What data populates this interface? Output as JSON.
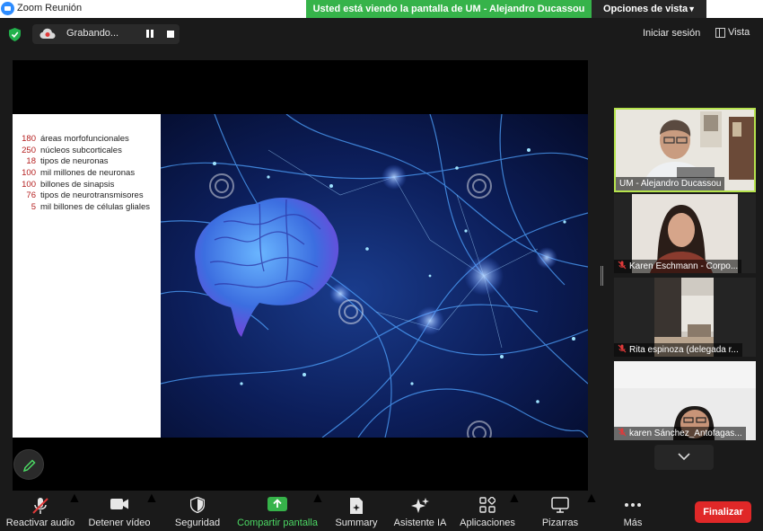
{
  "window": {
    "title": "Zoom Reunión",
    "sharing_banner": "Usted está viendo la pantalla de UM - Alejandro Ducassou",
    "view_options": "Opciones de vista"
  },
  "topbar": {
    "recording_label": "Grabando...",
    "signin": "Iniciar sesión",
    "view": "Vista"
  },
  "slide": {
    "facts": [
      {
        "num": "180",
        "text": "áreas morfofuncionales"
      },
      {
        "num": "250",
        "text": "núcleos subcorticales"
      },
      {
        "num": "18",
        "text": "tipos de neuronas"
      },
      {
        "num": "100",
        "text": "mil millones de neuronas"
      },
      {
        "num": "100",
        "text": "billones de sinapsis"
      },
      {
        "num": "76",
        "text": "tipos de neurotransmisores"
      },
      {
        "num": "5",
        "text": "mil billones de células gliales"
      }
    ]
  },
  "participants": [
    {
      "name": "UM - Alejandro Ducassou",
      "muted": false,
      "active": true
    },
    {
      "name": "Karen Eschmann - Corpo...",
      "muted": true
    },
    {
      "name": "Rita espinoza (delegada r...",
      "muted": true
    },
    {
      "name": "karen Sánchez_Antofagas...",
      "muted": true
    }
  ],
  "toolbar": {
    "audio": "Reactivar audio",
    "video": "Detener vídeo",
    "security": "Seguridad",
    "share": "Compartir pantalla",
    "summary": "Summary",
    "ai": "Asistente IA",
    "apps": "Aplicaciones",
    "whiteboards": "Pizarras",
    "more": "Más",
    "end": "Finalizar"
  },
  "colors": {
    "share_green": "#36b34a",
    "active_speaker": "#b6e34d",
    "end_red": "#e02828",
    "fact_number": "#b52020"
  }
}
